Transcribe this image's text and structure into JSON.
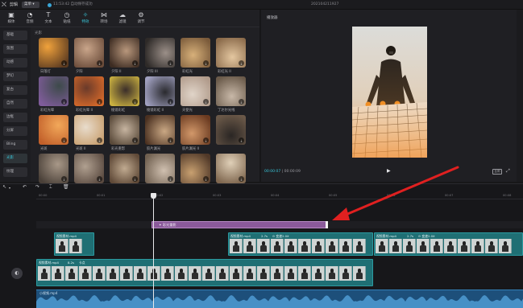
{
  "titlebar": {
    "app_name": "剪辑",
    "menu_label": "菜单",
    "save_status": "11:53:42 自动保存成功",
    "project_title": "202104211927"
  },
  "toptabs": [
    {
      "label": "媒体",
      "icon": "media-icon"
    },
    {
      "label": "音频",
      "icon": "audio-icon"
    },
    {
      "label": "文本",
      "icon": "text-icon"
    },
    {
      "label": "贴纸",
      "icon": "sticker-icon"
    },
    {
      "label": "特效",
      "icon": "effects-icon",
      "active": true
    },
    {
      "label": "转场",
      "icon": "transition-icon"
    },
    {
      "label": "滤镜",
      "icon": "filter-icon"
    },
    {
      "label": "调节",
      "icon": "adjust-icon"
    }
  ],
  "sidebar": [
    "基础",
    "氛围",
    "动感",
    "梦幻",
    "复古",
    "自然",
    "边框",
    "分屏",
    "Bling",
    "光影",
    "纹理"
  ],
  "sidebar_active_index": 9,
  "grid": {
    "section_title": "光影",
    "items": [
      {
        "label": "日落灯"
      },
      {
        "label": "夕阳"
      },
      {
        "label": "夕阳 II"
      },
      {
        "label": "夕阳 III"
      },
      {
        "label": "彩虹光"
      },
      {
        "label": "彩虹光 II"
      },
      {
        "label": "彩虹光晕"
      },
      {
        "label": "彩虹光晕 II"
      },
      {
        "label": "棱镜彩虹"
      },
      {
        "label": "棱镜彩虹 II"
      },
      {
        "label": "天使光"
      },
      {
        "label": "丁达尔光线"
      },
      {
        "label": "光斑"
      },
      {
        "label": "光斑 II"
      },
      {
        "label": "彩光重影"
      },
      {
        "label": "胶片漏光"
      },
      {
        "label": "胶片漏光 II"
      },
      {
        "label": ""
      },
      {
        "label": ""
      },
      {
        "label": ""
      },
      {
        "label": ""
      },
      {
        "label": ""
      },
      {
        "label": ""
      },
      {
        "label": ""
      }
    ]
  },
  "player": {
    "title": "播放器",
    "current_time": "00:00:07",
    "total_time": "00:00:09",
    "ratio_label": "比例"
  },
  "timeline": {
    "ruler_ticks": [
      "00:00",
      "00:01",
      "00:02",
      "00:03",
      "00:04",
      "00:05",
      "00:06",
      "00:07",
      "00:08"
    ],
    "effect_clip_label": "✦ 彩光重影",
    "video_clip_label": "视频素材.mp4",
    "video_clip_meta": "2.7s",
    "video_clip_speed": "⊙ 变速2.0X",
    "main_clip_label": "视频素材.mp4",
    "main_clip_meta": "8.2s",
    "main_clip_extra": "卡点",
    "audio_label": "小视频.mp4",
    "cover_label": "封面"
  },
  "colors": {
    "accent": "#39c6d9",
    "effect_clip": "#8a5a9a",
    "video_clip": "#1f6f74",
    "audio_clip": "#1d4f7a",
    "arrow": "#e02020"
  }
}
